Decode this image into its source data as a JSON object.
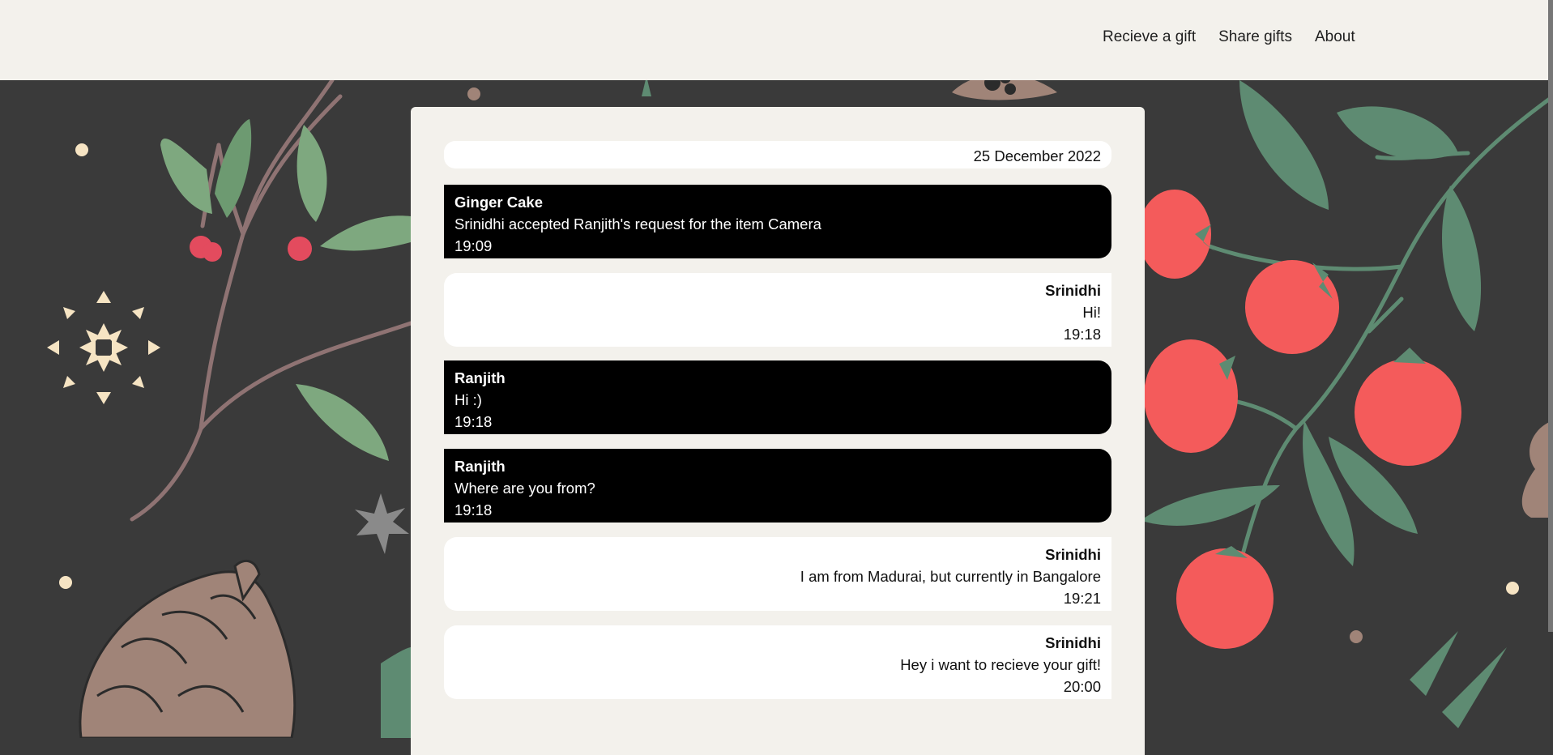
{
  "nav": {
    "receive": "Recieve a gift",
    "share": "Share gifts",
    "about": "About"
  },
  "chat": {
    "date": "25 December 2022",
    "messages": [
      {
        "sender": "Ginger Cake",
        "text": "Srinidhi accepted Ranjith's request for the item Camera",
        "time": "19:09",
        "side": "left"
      },
      {
        "sender": "Srinidhi",
        "text": "Hi!",
        "time": "19:18",
        "side": "right"
      },
      {
        "sender": "Ranjith",
        "text": "Hi :)",
        "time": "19:18",
        "side": "left"
      },
      {
        "sender": "Ranjith",
        "text": "Where are you from?",
        "time": "19:18",
        "side": "left"
      },
      {
        "sender": "Srinidhi",
        "text": "I am from Madurai, but currently in Bangalore",
        "time": "19:21",
        "side": "right"
      },
      {
        "sender": "Srinidhi",
        "text": "Hey i want to recieve your gift!",
        "time": "20:00",
        "side": "right"
      }
    ]
  },
  "colors": {
    "header_bg": "#f3f1ec",
    "page_bg": "#3a3a3a",
    "bubble_dark": "#000000",
    "bubble_light": "#ffffff",
    "berry": "#f45b5b",
    "leaf": "#5e8b72",
    "pinecone": "#a08478"
  }
}
